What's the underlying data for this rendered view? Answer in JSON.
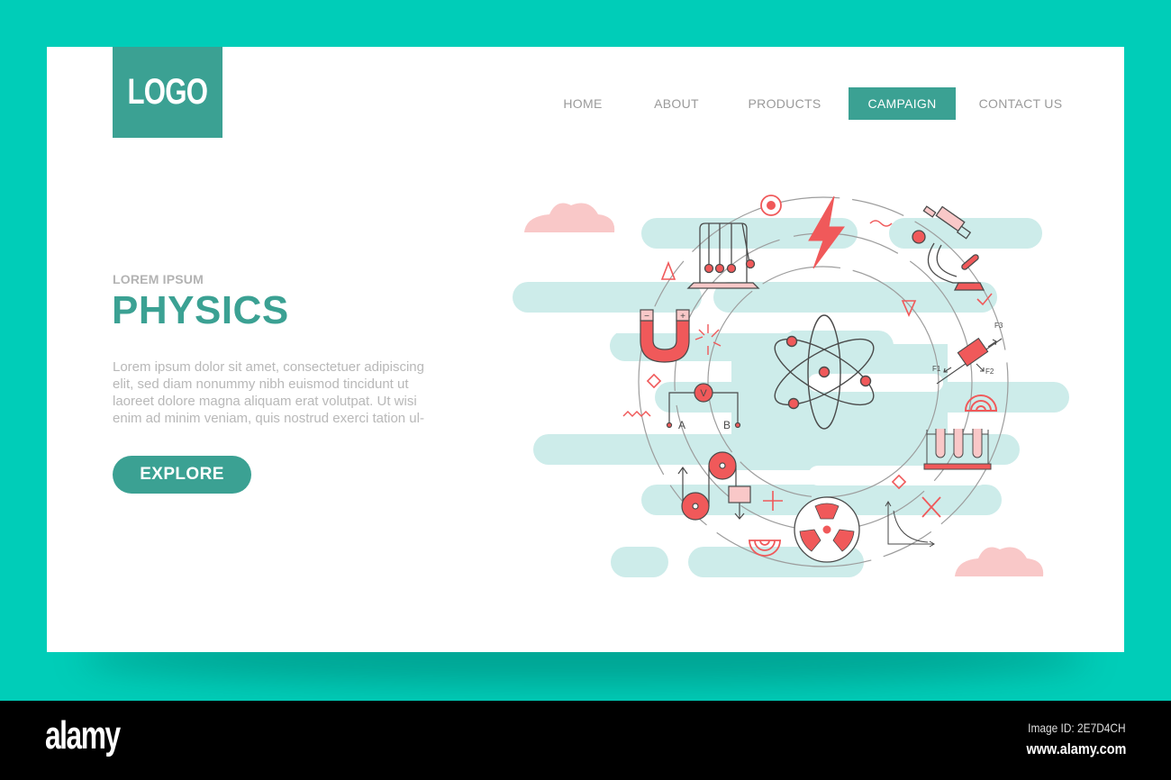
{
  "logo": {
    "label": "LOGO"
  },
  "nav": {
    "items": [
      {
        "label": "HOME",
        "active": false
      },
      {
        "label": "ABOUT",
        "active": false
      },
      {
        "label": "PRODUCTS",
        "active": false
      },
      {
        "label": "CAMPAIGN",
        "active": true
      },
      {
        "label": "CONTACT US",
        "active": false
      }
    ]
  },
  "hero": {
    "eyebrow": "LOREM IPSUM",
    "title": "PHYSICS",
    "body_lines": [
      "Lorem ipsum dolor sit amet, consectetuer adipiscing",
      "elit, sed diam nonummy nibh euismod tincidunt ut",
      "laoreet dolore magna aliquam erat volutpat. Ut wisi",
      "enim ad minim veniam, quis nostrud exerci tation ul-"
    ],
    "cta_label": "EXPLORE"
  },
  "illustration": {
    "icons": [
      "newtons-cradle",
      "lightning-bolt",
      "microscope",
      "magnet",
      "atom",
      "inclined-plane-forces",
      "voltmeter-circuit",
      "test-tubes",
      "pulley-system",
      "radiation-symbol",
      "decay-graph",
      "target",
      "rainbow-arc"
    ],
    "labels": {
      "voltmeter": "V",
      "point_a": "A",
      "point_b": "B",
      "force_1": "F1",
      "force_2": "F2",
      "force_3": "F3",
      "magnet_minus": "−",
      "magnet_plus": "+"
    }
  },
  "colors": {
    "background": "#00CDB8",
    "accent": "#3BA193",
    "icon_red": "#F0595A",
    "icon_pink": "#F9C8C8",
    "mint": "#CDECEA",
    "outline": "#4A4A4A"
  },
  "footer": {
    "brand": "alamy",
    "image_id": "Image ID: 2E7D4CH",
    "site": "www.alamy.com"
  }
}
